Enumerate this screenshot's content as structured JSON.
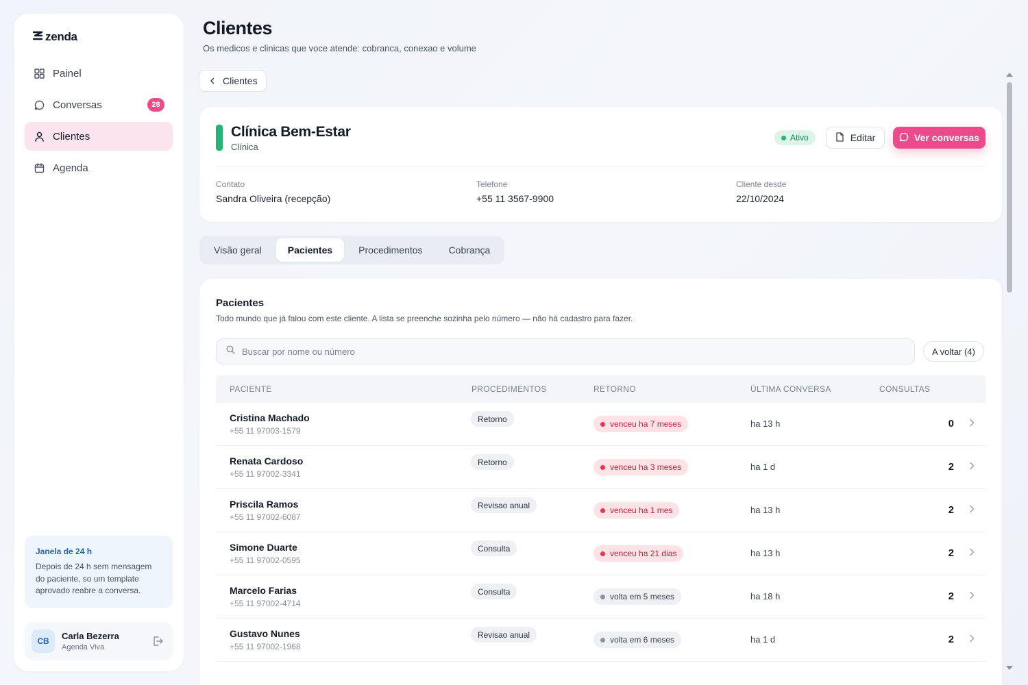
{
  "brand": {
    "name": "zenda"
  },
  "nav": [
    {
      "label": "Painel",
      "icon": "grid-icon",
      "active": false
    },
    {
      "label": "Conversas",
      "icon": "chat-icon",
      "badge": "28",
      "active": false
    },
    {
      "label": "Clientes",
      "icon": "user-icon",
      "active": true
    },
    {
      "label": "Agenda",
      "icon": "calendar-icon",
      "active": false
    }
  ],
  "info_box": {
    "title": "Janela de 24 h",
    "text": "Depois de 24 h sem mensagem do paciente, so um template aprovado reabre a conversa."
  },
  "user": {
    "initials": "CB",
    "name": "Carla Bezerra",
    "org": "Agenda Viva"
  },
  "header": {
    "title": "Clientes",
    "subtitle": "Os medicos e clinicas que voce atende: cobranca, conexao e volume"
  },
  "back_button": {
    "label": "Clientes"
  },
  "client": {
    "name": "Clínica Bem-Estar",
    "type": "Clínica",
    "status": "Ativo",
    "edit_label": "Editar",
    "conversations_label": "Ver conversas",
    "fields": [
      {
        "label": "Contato",
        "value": "Sandra Oliveira (recepção)"
      },
      {
        "label": "Telefone",
        "value": "+55 11 3567-9900"
      },
      {
        "label": "Cliente desde",
        "value": "22/10/2024"
      }
    ]
  },
  "tabs": [
    {
      "label": "Visão geral",
      "active": false
    },
    {
      "label": "Pacientes",
      "active": true
    },
    {
      "label": "Procedimentos",
      "active": false
    },
    {
      "label": "Cobrança",
      "active": false
    }
  ],
  "patients": {
    "title": "Pacientes",
    "description": "Todo mundo que já falou com este cliente. A lista se preenche sozinha pelo número — não há cadastro para fazer.",
    "search_placeholder": "Buscar por nome ou número",
    "filter_label": "A voltar (4)",
    "columns": [
      "Paciente",
      "Procedimentos",
      "Retorno",
      "Última conversa",
      "Consultas"
    ],
    "rows": [
      {
        "name": "Cristina Machado",
        "phone": "+55 11 97003-1579",
        "procedure": "Retorno",
        "return": "venceu ha 7 meses",
        "return_status": "overdue",
        "last": "ha 13 h",
        "count": "0"
      },
      {
        "name": "Renata Cardoso",
        "phone": "+55 11 97002-3341",
        "procedure": "Retorno",
        "return": "venceu ha 3 meses",
        "return_status": "overdue",
        "last": "ha 1 d",
        "count": "2"
      },
      {
        "name": "Priscila Ramos",
        "phone": "+55 11 97002-6087",
        "procedure": "Revisao anual",
        "return": "venceu ha 1 mes",
        "return_status": "overdue",
        "last": "ha 13 h",
        "count": "2"
      },
      {
        "name": "Simone Duarte",
        "phone": "+55 11 97002-0595",
        "procedure": "Consulta",
        "return": "venceu ha 21 dias",
        "return_status": "overdue",
        "last": "ha 13 h",
        "count": "2"
      },
      {
        "name": "Marcelo Farias",
        "phone": "+55 11 97002-4714",
        "procedure": "Consulta",
        "return": "volta em 5 meses",
        "return_status": "future",
        "last": "ha 18 h",
        "count": "2"
      },
      {
        "name": "Gustavo Nunes",
        "phone": "+55 11 97002-1968",
        "procedure": "Revisao anual",
        "return": "volta em 6 meses",
        "return_status": "future",
        "last": "ha 1 d",
        "count": "2"
      }
    ]
  },
  "colors": {
    "accent": "#ec4a8a",
    "success": "#22b573",
    "danger": "#e53551",
    "link": "#2563b0"
  }
}
